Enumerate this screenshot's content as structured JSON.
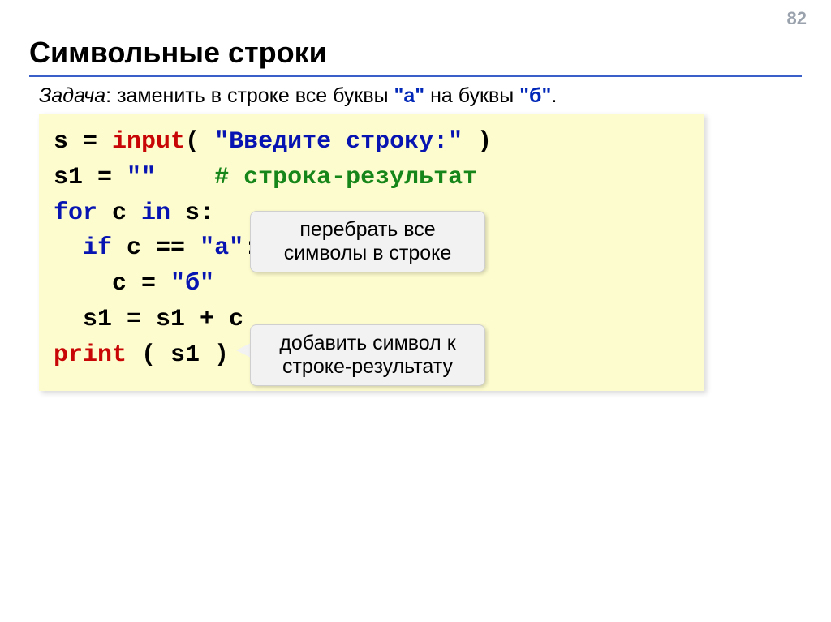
{
  "page_number": "82",
  "title": "Символьные строки",
  "task": {
    "label": "Задача",
    "sep": ": ",
    "text1": "заменить в строке все буквы ",
    "qa": "\"а\"",
    "text2": " на буквы ",
    "qb": "\"б\"",
    "end": "."
  },
  "code": {
    "l1_s": "s",
    "l1_eq": " = ",
    "l1_input": "input",
    "l1_open": "( ",
    "l1_str": "\"Введите строку:\"",
    "l1_close": " )",
    "l2_s1": "s1",
    "l2_eq": " = ",
    "l2_empty": "\"\"",
    "l2_pad": "    ",
    "l2_cmt": "# строка-результат",
    "l3_for": "for",
    "l3_sp1": " c ",
    "l3_in": "in",
    "l3_sp2": " s:",
    "l4_pad": "  ",
    "l4_if": "if",
    "l4_cond1": " c",
    "l4_eqeq": " == ",
    "l4_a": "\"а\"",
    "l4_colon": ":",
    "l5_pad": "    ",
    "l5_c": "c",
    "l5_eq": " = ",
    "l5_b": "\"б\"",
    "l6_pad": "  ",
    "l6_expr": "s1 = s1 + c",
    "l7_print": "print",
    "l7_args": " ( s1 )"
  },
  "callout1": "перебрать все символы в строке",
  "callout2": "добавить символ к строке-результату"
}
